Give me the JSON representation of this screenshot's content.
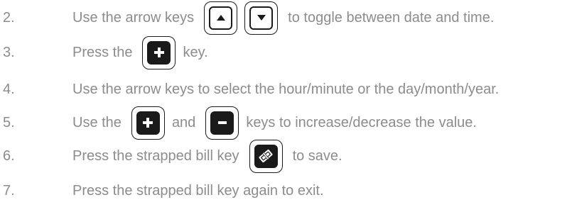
{
  "steps": [
    {
      "num": "2.",
      "before": "Use the arrow keys",
      "after": "to toggle between date and time.",
      "icons": [
        "caret-up-icon",
        "caret-down-icon"
      ]
    },
    {
      "num": "3.",
      "before": "Press the",
      "after": "key.",
      "icons": [
        "plus-icon"
      ]
    },
    {
      "num": "4.",
      "text": "Use the arrow keys to select the hour/minute or the day/month/year."
    },
    {
      "num": "5.",
      "before": "Use the",
      "middle": "and",
      "after": "keys to increase/decrease the value.",
      "icons": [
        "plus-icon",
        "minus-icon"
      ]
    },
    {
      "num": "6.",
      "before": "Press the strapped bill key",
      "after": "to save.",
      "icons": [
        "strapped-bill-icon"
      ]
    },
    {
      "num": "7.",
      "text": "Press the strapped bill key again to exit."
    }
  ],
  "colors": {
    "text": "#8c8c8c",
    "key_border": "#1a1a1a",
    "key_fill": "#1a1a1a"
  }
}
